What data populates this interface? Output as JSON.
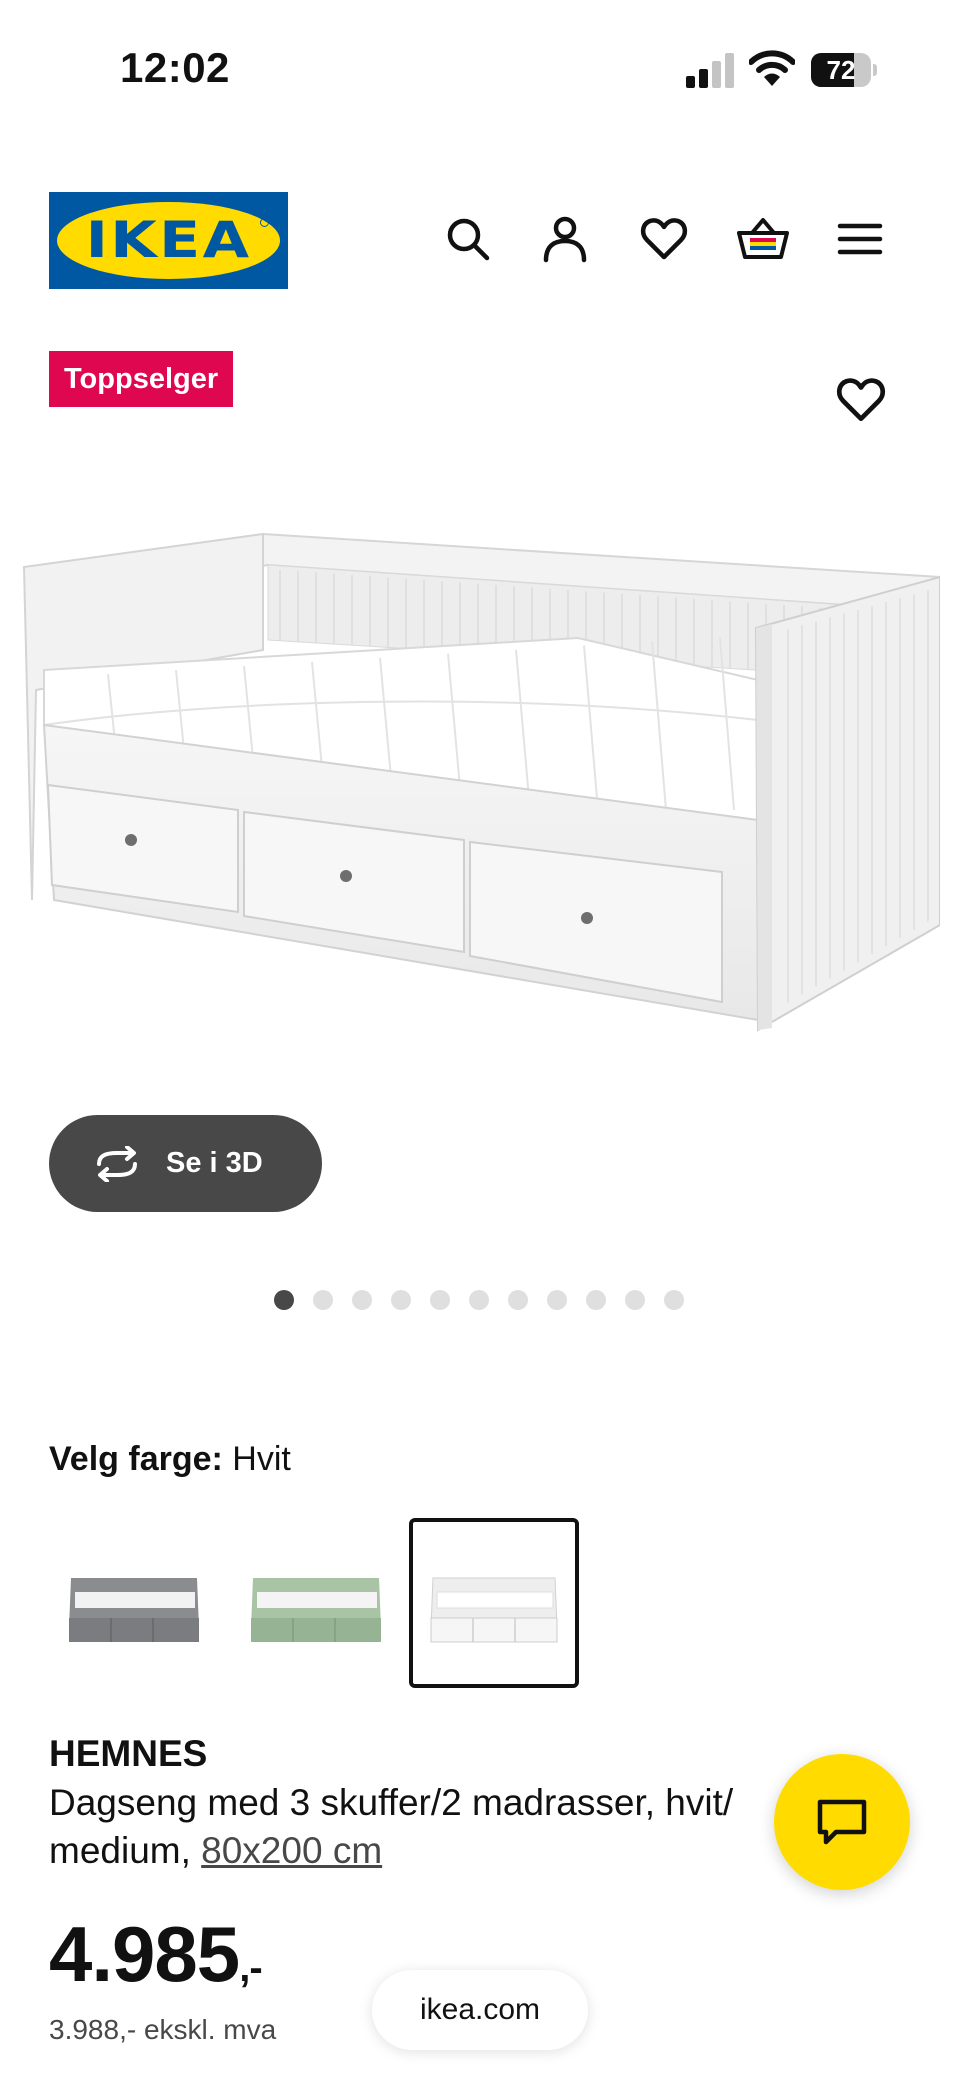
{
  "status_bar": {
    "time": "12:02",
    "battery_percent": 72,
    "battery_label": "72",
    "signal_bars_active": 2
  },
  "header": {
    "logo_text": "IKEA",
    "icons": [
      "search-icon",
      "account-icon",
      "heart-icon",
      "basket-icon",
      "menu-icon"
    ]
  },
  "badge": {
    "label": "Toppselger",
    "color": "#e00751"
  },
  "product_image": {
    "alt": "HEMNES dagseng hvit"
  },
  "view_3d": {
    "label": "Se i 3D",
    "icon": "rotate-icon"
  },
  "carousel": {
    "count": 11,
    "active_index": 0
  },
  "color_picker": {
    "label": "Velg farge:",
    "selected": "Hvit",
    "options": [
      {
        "name": "Grå",
        "color": "#8a8c90",
        "selected": false
      },
      {
        "name": "Grønn",
        "color": "#a8c4a5",
        "selected": false
      },
      {
        "name": "Hvit",
        "color": "#f2f2f2",
        "selected": true
      }
    ]
  },
  "product": {
    "name": "HEMNES",
    "description_line1": "Dagseng med 3 skuffer/2 madrasser, hvit/",
    "description_line2_prefix": "medium, ",
    "size_link": "80x200 cm"
  },
  "price": {
    "value": "4.985",
    "suffix": ",-",
    "ex_vat": "3.988,- ekskl. mva"
  },
  "browser": {
    "url": "ikea.com"
  },
  "chat": {
    "icon": "chat-icon"
  },
  "colors": {
    "ikea_blue": "#0058a3",
    "ikea_yellow": "#ffdb00",
    "badge_pink": "#e00751",
    "dark_button": "#484848"
  }
}
